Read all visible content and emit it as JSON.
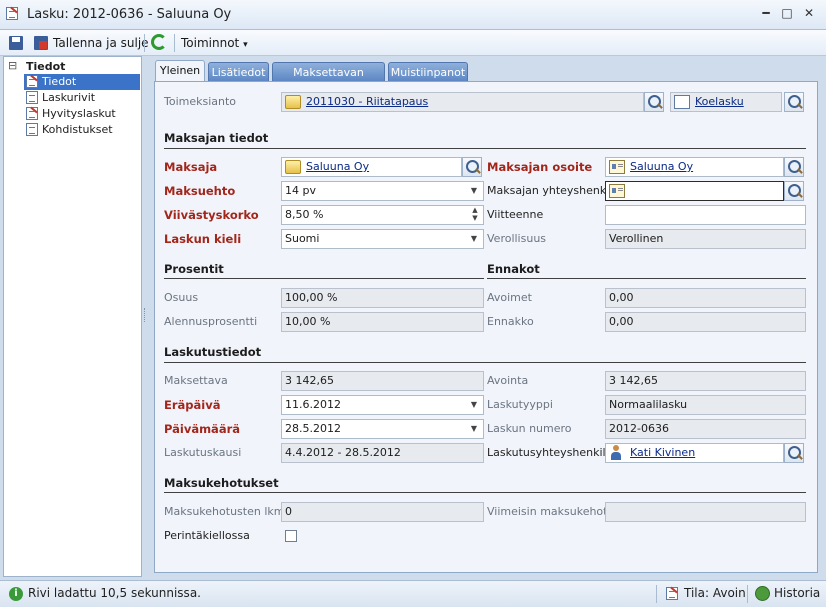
{
  "window": {
    "title": "Lasku: 2012-0636 - Saluuna Oy",
    "minimize": "━",
    "maximize": "□",
    "close": "✕"
  },
  "toolbar": {
    "save_close_label": "Tallenna ja sulje",
    "actions_label": "Toiminnot",
    "actions_caret": "▾"
  },
  "tree": {
    "root_toggle": "⊟",
    "root_label": "Tiedot",
    "items": [
      "Tiedot",
      "Laskurivit",
      "Hyvityslaskut",
      "Kohdistukset"
    ]
  },
  "tabs": [
    "Yleinen",
    "Lisätiedot",
    "Maksettavan erittely",
    "Muistiinpanot"
  ],
  "general": {
    "toimeksianto_label": "Toimeksianto",
    "toimeksianto_value": "2011030 - Riitatapaus",
    "koelasku_value": "Koelasku"
  },
  "payer": {
    "section": "Maksajan tiedot",
    "maksaja_label": "Maksaja",
    "maksaja_value": "Saluuna Oy",
    "maksuehto_label": "Maksuehto",
    "maksuehto_value": "14 pv",
    "viivastyskorko_label": "Viivästyskorko",
    "viivastyskorko_value": "8,50 %",
    "laskun_kieli_label": "Laskun kieli",
    "laskun_kieli_value": "Suomi",
    "osoite_label": "Maksajan osoite",
    "osoite_value": "Saluuna Oy",
    "yhteyshenkilo_label": "Maksajan yhteyshenkilö",
    "yhteyshenkilo_value": "",
    "viitteenne_label": "Viitteenne",
    "viitteenne_value": "",
    "verollisuus_label": "Verollisuus",
    "verollisuus_value": "Verollinen"
  },
  "percent": {
    "section": "Prosentit",
    "osuus_label": "Osuus",
    "osuus_value": "100,00 %",
    "alennus_label": "Alennusprosentti",
    "alennus_value": "10,00 %"
  },
  "advance": {
    "section": "Ennakot",
    "avoimet_label": "Avoimet",
    "avoimet_value": "0,00",
    "ennakko_label": "Ennakko",
    "ennakko_value": "0,00"
  },
  "billing": {
    "section": "Laskutustiedot",
    "maksettava_label": "Maksettava",
    "maksettava_value": "3 142,65",
    "erapaiva_label": "Eräpäivä",
    "erapaiva_value": "11.6.2012",
    "paivamaara_label": "Päivämäärä",
    "paivamaara_value": "28.5.2012",
    "laskutuskausi_label": "Laskutuskausi",
    "laskutuskausi_value": "4.4.2012 - 28.5.2012",
    "avointa_label": "Avointa",
    "avointa_value": "3 142,65",
    "laskutyyppi_label": "Laskutyyppi",
    "laskutyyppi_value": "Normaalilasku",
    "laskun_numero_label": "Laskun numero",
    "laskun_numero_value": "2012-0636",
    "yhteyshenkilo_label": "Laskutusyhteyshenkilö",
    "yhteyshenkilo_value": "Kati Kivinen"
  },
  "reminders": {
    "section": "Maksukehotukset",
    "lkm_label": "Maksukehotusten lkm",
    "lkm_value": "0",
    "perinta_label": "Perintäkiellossa",
    "viimeisin_label": "Viimeisin maksukehotus",
    "viimeisin_value": ""
  },
  "status": {
    "message": "Rivi ladattu 10,5 sekunnissa.",
    "state": "Tila: Avoin",
    "history": "Historia"
  },
  "colors": {
    "required_label": "#a3261b",
    "link": "#0b2a86",
    "tab_active_bg": "#f1f5fb",
    "selection": "#3a73c7"
  }
}
